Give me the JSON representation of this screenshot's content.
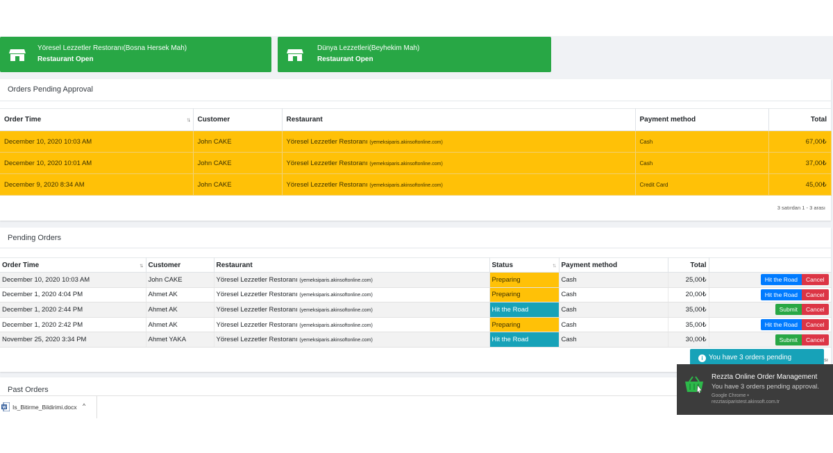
{
  "restaurants": [
    {
      "name": "Yöresel Lezzetler Restoranı(Bosna Hersek Mah)",
      "status": "Restaurant Open",
      "icon": "store-icon"
    },
    {
      "name": "Dünya Lezzetleri(Beyhekim Mah)",
      "status": "Restaurant Open",
      "icon": "store-icon"
    }
  ],
  "pending_approval": {
    "title": "Orders Pending Approval",
    "columns": [
      "Order Time",
      "Customer",
      "Restaurant",
      "Payment method",
      "Total"
    ],
    "rows": [
      {
        "time": "December 10, 2020 10:03 AM",
        "customer": "John CAKE",
        "restaurant": "Yöresel Lezzetler Restoranı",
        "domain": "(yemeksiparis.akinsoftonline.com)",
        "payment": "Cash",
        "total": "67,00₺"
      },
      {
        "time": "December 10, 2020 10:01 AM",
        "customer": "John CAKE",
        "restaurant": "Yöresel Lezzetler Restoranı",
        "domain": "(yemeksiparis.akinsoftonline.com)",
        "payment": "Cash",
        "total": "37,00₺"
      },
      {
        "time": "December 9, 2020 8:34 AM",
        "customer": "John CAKE",
        "restaurant": "Yöresel Lezzetler Restoranı",
        "domain": "(yemeksiparis.akinsoftonline.com)",
        "payment": "Credit Card",
        "total": "45,00₺"
      }
    ],
    "pagination": "3 satırdan 1 - 3 arası"
  },
  "pending_orders": {
    "title": "Pending Orders",
    "columns": [
      "Order Time",
      "Customer",
      "Restaurant",
      "Status",
      "Payment method",
      "Total"
    ],
    "rows": [
      {
        "time": "December 10, 2020 10:03 AM",
        "customer": "John CAKE",
        "restaurant": "Yöresel Lezzetler Restoranı",
        "domain": "(yemeksiparis.akinsoftonline.com)",
        "status": "Preparing",
        "payment": "Cash",
        "total": "25,00₺",
        "action": "Hit the Road",
        "cancel": "Cancel"
      },
      {
        "time": "December 1, 2020 4:04 PM",
        "customer": "Ahmet AK",
        "restaurant": "Yöresel Lezzetler Restoranı",
        "domain": "(yemeksiparis.akinsoftonline.com)",
        "status": "Preparing",
        "payment": "Cash",
        "total": "20,00₺",
        "action": "Hit the Road",
        "cancel": "Cancel"
      },
      {
        "time": "December 1, 2020 2:44 PM",
        "customer": "Ahmet AK",
        "restaurant": "Yöresel Lezzetler Restoranı",
        "domain": "(yemeksiparis.akinsoftonline.com)",
        "status": "Hit the Road",
        "payment": "Cash",
        "total": "35,00₺",
        "action": "Submit",
        "cancel": "Cancel"
      },
      {
        "time": "December 1, 2020 2:42 PM",
        "customer": "Ahmet AK",
        "restaurant": "Yöresel Lezzetler Restoranı",
        "domain": "(yemeksiparis.akinsoftonline.com)",
        "status": "Preparing",
        "payment": "Cash",
        "total": "35,00₺",
        "action": "Hit the Road",
        "cancel": "Cancel"
      },
      {
        "time": "November 25, 2020 3:34 PM",
        "customer": "Ahmet YAKA",
        "restaurant": "Yöresel Lezzetler Restoranı",
        "domain": "(yemeksiparis.akinsoftonline.com)",
        "status": "Hit the Road",
        "payment": "Cash",
        "total": "30,00₺",
        "action": "Submit",
        "cancel": "Cancel"
      }
    ],
    "pagination_fragment": "sı"
  },
  "past_orders": {
    "title": "Past Orders"
  },
  "toast": {
    "text": "You have 3 orders pending",
    "icon": "info-icon"
  },
  "notification": {
    "title": "Rezzta Online Order Management",
    "message": "You have 3 orders pending approval.",
    "source": "Google Chrome •",
    "host": "rezztasiparistest.akinsoft.com.tr",
    "icon": "basket-icon"
  },
  "download": {
    "filename": "Is_Bitirme_Bildirimi.docx",
    "icon": "word-file-icon"
  },
  "colors": {
    "green": "#28a745",
    "yellow": "#ffc107",
    "teal": "#17a2b8",
    "blue": "#007bff",
    "red": "#dc3545"
  }
}
